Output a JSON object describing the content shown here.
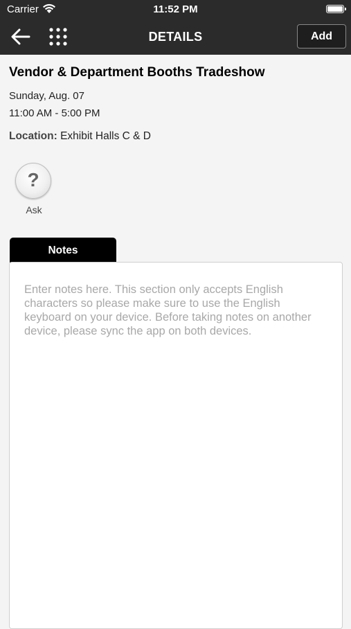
{
  "status_bar": {
    "carrier": "Carrier",
    "time": "11:52 PM",
    "wifi_icon": "wifi-icon",
    "battery_icon": "battery-full-icon",
    "battery_level": 1.0
  },
  "nav_bar": {
    "title": "DETAILS",
    "add_label": "Add",
    "back_icon": "arrow-left-icon",
    "menu_icon": "grid-icon"
  },
  "event": {
    "title": "Vendor & Department Booths Tradeshow",
    "date": "Sunday, Aug. 07",
    "time": "11:00 AM - 5:00 PM",
    "location_label": "Location:",
    "location_value": "Exhibit Halls C & D"
  },
  "ask": {
    "label": "Ask",
    "icon": "question-mark-icon"
  },
  "notes": {
    "tab_label": "Notes",
    "value": "",
    "placeholder": "Enter notes here. This section only accepts English characters so please make sure to use the English keyboard on your device. Before taking notes on another device, please sync the app on both devices."
  },
  "colors": {
    "bar_background": "#2b2b2b",
    "page_background": "#f4f4f4",
    "tab_background": "#000000"
  }
}
